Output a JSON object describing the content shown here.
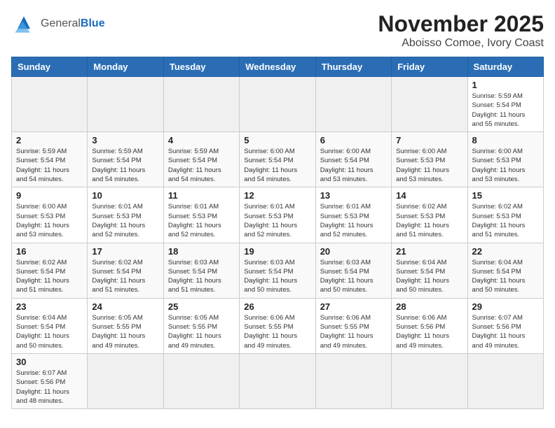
{
  "header": {
    "logo_general": "General",
    "logo_blue": "Blue",
    "month": "November 2025",
    "location": "Aboisso Comoe, Ivory Coast"
  },
  "weekdays": [
    "Sunday",
    "Monday",
    "Tuesday",
    "Wednesday",
    "Thursday",
    "Friday",
    "Saturday"
  ],
  "weeks": [
    [
      {
        "day": "",
        "info": ""
      },
      {
        "day": "",
        "info": ""
      },
      {
        "day": "",
        "info": ""
      },
      {
        "day": "",
        "info": ""
      },
      {
        "day": "",
        "info": ""
      },
      {
        "day": "",
        "info": ""
      },
      {
        "day": "1",
        "info": "Sunrise: 5:59 AM\nSunset: 5:54 PM\nDaylight: 11 hours\nand 55 minutes."
      }
    ],
    [
      {
        "day": "2",
        "info": "Sunrise: 5:59 AM\nSunset: 5:54 PM\nDaylight: 11 hours\nand 54 minutes."
      },
      {
        "day": "3",
        "info": "Sunrise: 5:59 AM\nSunset: 5:54 PM\nDaylight: 11 hours\nand 54 minutes."
      },
      {
        "day": "4",
        "info": "Sunrise: 5:59 AM\nSunset: 5:54 PM\nDaylight: 11 hours\nand 54 minutes."
      },
      {
        "day": "5",
        "info": "Sunrise: 6:00 AM\nSunset: 5:54 PM\nDaylight: 11 hours\nand 54 minutes."
      },
      {
        "day": "6",
        "info": "Sunrise: 6:00 AM\nSunset: 5:54 PM\nDaylight: 11 hours\nand 53 minutes."
      },
      {
        "day": "7",
        "info": "Sunrise: 6:00 AM\nSunset: 5:53 PM\nDaylight: 11 hours\nand 53 minutes."
      },
      {
        "day": "8",
        "info": "Sunrise: 6:00 AM\nSunset: 5:53 PM\nDaylight: 11 hours\nand 53 minutes."
      }
    ],
    [
      {
        "day": "9",
        "info": "Sunrise: 6:00 AM\nSunset: 5:53 PM\nDaylight: 11 hours\nand 53 minutes."
      },
      {
        "day": "10",
        "info": "Sunrise: 6:01 AM\nSunset: 5:53 PM\nDaylight: 11 hours\nand 52 minutes."
      },
      {
        "day": "11",
        "info": "Sunrise: 6:01 AM\nSunset: 5:53 PM\nDaylight: 11 hours\nand 52 minutes."
      },
      {
        "day": "12",
        "info": "Sunrise: 6:01 AM\nSunset: 5:53 PM\nDaylight: 11 hours\nand 52 minutes."
      },
      {
        "day": "13",
        "info": "Sunrise: 6:01 AM\nSunset: 5:53 PM\nDaylight: 11 hours\nand 52 minutes."
      },
      {
        "day": "14",
        "info": "Sunrise: 6:02 AM\nSunset: 5:53 PM\nDaylight: 11 hours\nand 51 minutes."
      },
      {
        "day": "15",
        "info": "Sunrise: 6:02 AM\nSunset: 5:53 PM\nDaylight: 11 hours\nand 51 minutes."
      }
    ],
    [
      {
        "day": "16",
        "info": "Sunrise: 6:02 AM\nSunset: 5:54 PM\nDaylight: 11 hours\nand 51 minutes."
      },
      {
        "day": "17",
        "info": "Sunrise: 6:02 AM\nSunset: 5:54 PM\nDaylight: 11 hours\nand 51 minutes."
      },
      {
        "day": "18",
        "info": "Sunrise: 6:03 AM\nSunset: 5:54 PM\nDaylight: 11 hours\nand 51 minutes."
      },
      {
        "day": "19",
        "info": "Sunrise: 6:03 AM\nSunset: 5:54 PM\nDaylight: 11 hours\nand 50 minutes."
      },
      {
        "day": "20",
        "info": "Sunrise: 6:03 AM\nSunset: 5:54 PM\nDaylight: 11 hours\nand 50 minutes."
      },
      {
        "day": "21",
        "info": "Sunrise: 6:04 AM\nSunset: 5:54 PM\nDaylight: 11 hours\nand 50 minutes."
      },
      {
        "day": "22",
        "info": "Sunrise: 6:04 AM\nSunset: 5:54 PM\nDaylight: 11 hours\nand 50 minutes."
      }
    ],
    [
      {
        "day": "23",
        "info": "Sunrise: 6:04 AM\nSunset: 5:54 PM\nDaylight: 11 hours\nand 50 minutes."
      },
      {
        "day": "24",
        "info": "Sunrise: 6:05 AM\nSunset: 5:55 PM\nDaylight: 11 hours\nand 49 minutes."
      },
      {
        "day": "25",
        "info": "Sunrise: 6:05 AM\nSunset: 5:55 PM\nDaylight: 11 hours\nand 49 minutes."
      },
      {
        "day": "26",
        "info": "Sunrise: 6:06 AM\nSunset: 5:55 PM\nDaylight: 11 hours\nand 49 minutes."
      },
      {
        "day": "27",
        "info": "Sunrise: 6:06 AM\nSunset: 5:55 PM\nDaylight: 11 hours\nand 49 minutes."
      },
      {
        "day": "28",
        "info": "Sunrise: 6:06 AM\nSunset: 5:56 PM\nDaylight: 11 hours\nand 49 minutes."
      },
      {
        "day": "29",
        "info": "Sunrise: 6:07 AM\nSunset: 5:56 PM\nDaylight: 11 hours\nand 49 minutes."
      }
    ],
    [
      {
        "day": "30",
        "info": "Sunrise: 6:07 AM\nSunset: 5:56 PM\nDaylight: 11 hours\nand 48 minutes."
      },
      {
        "day": "",
        "info": ""
      },
      {
        "day": "",
        "info": ""
      },
      {
        "day": "",
        "info": ""
      },
      {
        "day": "",
        "info": ""
      },
      {
        "day": "",
        "info": ""
      },
      {
        "day": "",
        "info": ""
      }
    ]
  ]
}
